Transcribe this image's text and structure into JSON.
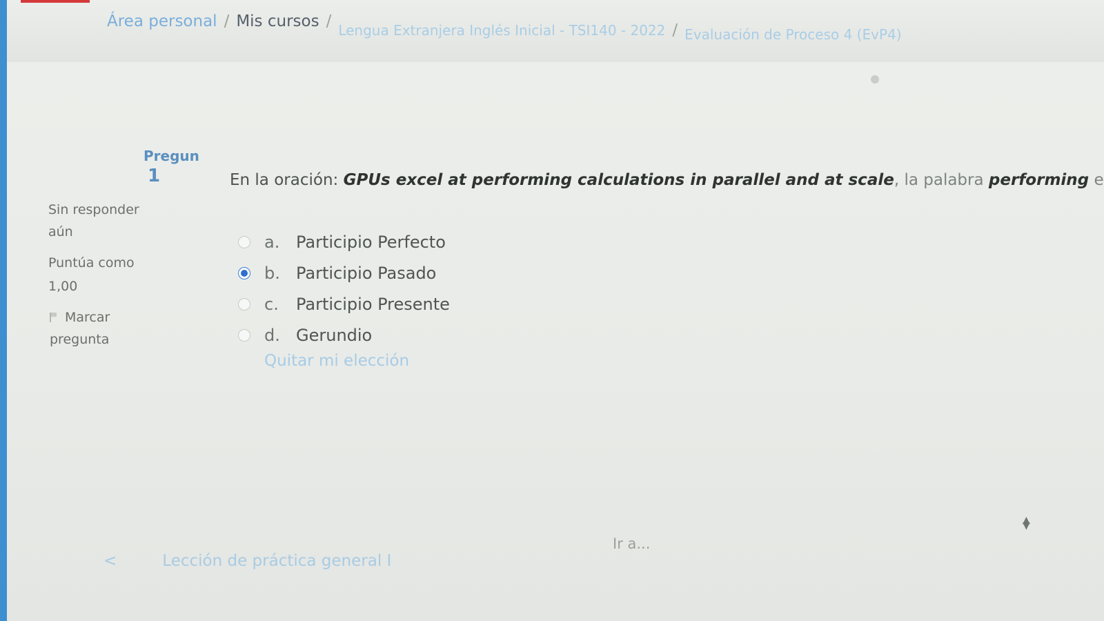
{
  "breadcrumb": {
    "items": [
      "Área personal",
      "Mis cursos",
      "Lengua Extranjera Inglés Inicial - TSI140 - 2022",
      "Evaluación de Proceso 4 (EvP4)"
    ],
    "separator": "/"
  },
  "question": {
    "label": "Pregun",
    "number": "1",
    "state": "Sin responder aún",
    "grade": "Puntúa como 1,00",
    "flag_label": "Marcar pregunta",
    "text_prefix": "En la oración: ",
    "sentence": "GPUs excel at performing calculations in parallel and at scale",
    "text_mid": ", la palabra ",
    "keyword": "performing",
    "text_suffix": " es:",
    "answers": [
      {
        "letter": "a.",
        "label": "Participio Perfecto",
        "selected": false
      },
      {
        "letter": "b.",
        "label": "Participio Pasado",
        "selected": true
      },
      {
        "letter": "c.",
        "label": "Participio Presente",
        "selected": false
      },
      {
        "letter": "d.",
        "label": "Gerundio",
        "selected": false
      }
    ],
    "clear_choice": "Quitar mi elección"
  },
  "navigation": {
    "prev_arrow": "<",
    "prev_label": "Lección de práctica general I",
    "jump_label": "Ir a..."
  },
  "colors": {
    "link": "#7aaedb",
    "selected_radio": "#2f6fd0",
    "left_bar": "#3e8ed0",
    "top_accent": "#d53a3a"
  }
}
